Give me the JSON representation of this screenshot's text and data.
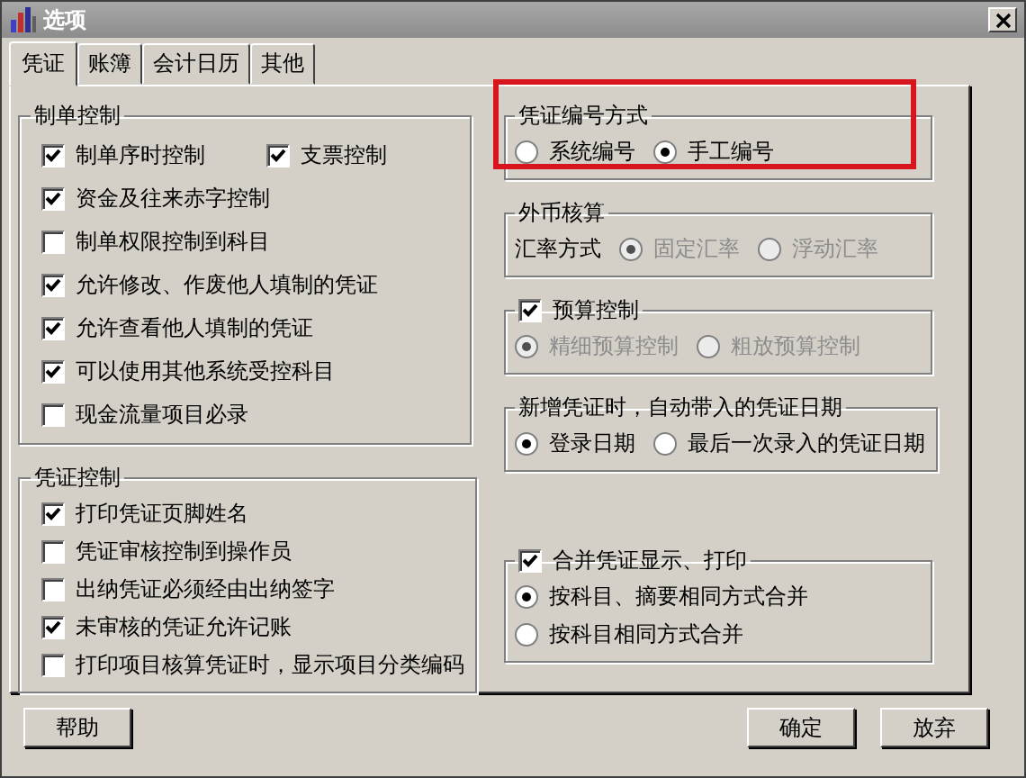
{
  "window": {
    "title": "选项"
  },
  "tabs": [
    {
      "label": "凭证",
      "selected": true
    },
    {
      "label": "账簿",
      "selected": false
    },
    {
      "label": "会计日历",
      "selected": false
    },
    {
      "label": "其他",
      "selected": false
    }
  ],
  "left_groups": [
    {
      "highlighted": false,
      "header": {
        "kind": "text",
        "label": "制单控制"
      },
      "rows": [
        [
          {
            "kind": "checkbox",
            "label": "制单序时控制",
            "checked": true,
            "disabled": false
          },
          {
            "kind": "checkbox",
            "label": "支票控制",
            "checked": true,
            "disabled": false
          }
        ],
        [
          {
            "kind": "checkbox",
            "label": "资金及往来赤字控制",
            "checked": true,
            "disabled": false
          }
        ],
        [
          {
            "kind": "checkbox",
            "label": "制单权限控制到科目",
            "checked": false,
            "disabled": false
          }
        ],
        [
          {
            "kind": "checkbox",
            "label": "允许修改、作废他人填制的凭证",
            "checked": true,
            "disabled": false
          }
        ],
        [
          {
            "kind": "checkbox",
            "label": "允许查看他人填制的凭证",
            "checked": true,
            "disabled": false
          }
        ],
        [
          {
            "kind": "checkbox",
            "label": "可以使用其他系统受控科目",
            "checked": true,
            "disabled": false
          }
        ],
        [
          {
            "kind": "checkbox",
            "label": "现金流量项目必录",
            "checked": false,
            "disabled": false
          }
        ]
      ]
    },
    {
      "highlighted": false,
      "header": {
        "kind": "text",
        "label": "凭证控制"
      },
      "rows": [
        [
          {
            "kind": "checkbox",
            "label": "打印凭证页脚姓名",
            "checked": true,
            "disabled": false
          }
        ],
        [
          {
            "kind": "checkbox",
            "label": "凭证审核控制到操作员",
            "checked": false,
            "disabled": false
          }
        ],
        [
          {
            "kind": "checkbox",
            "label": "出纳凭证必须经由出纳签字",
            "checked": false,
            "disabled": false
          }
        ],
        [
          {
            "kind": "checkbox",
            "label": "未审核的凭证允许记账",
            "checked": true,
            "disabled": false
          }
        ],
        [
          {
            "kind": "checkbox",
            "label": "打印项目核算凭证时，显示项目分类编码",
            "checked": false,
            "disabled": false
          }
        ]
      ]
    }
  ],
  "right_groups": [
    {
      "highlighted": true,
      "header": {
        "kind": "text",
        "label": "凭证编号方式"
      },
      "rows": [
        [
          {
            "kind": "radio",
            "label": "系统编号",
            "selected": false,
            "disabled": false
          },
          {
            "kind": "radio",
            "label": "手工编号",
            "selected": true,
            "disabled": false
          }
        ]
      ]
    },
    {
      "highlighted": false,
      "header": {
        "kind": "text",
        "label": "外币核算"
      },
      "rows": [
        [
          {
            "kind": "text",
            "label": "汇率方式",
            "disabled": false
          },
          {
            "kind": "radio",
            "label": "固定汇率",
            "selected": true,
            "disabled": true
          },
          {
            "kind": "radio",
            "label": "浮动汇率",
            "selected": false,
            "disabled": true
          }
        ]
      ]
    },
    {
      "highlighted": false,
      "header": {
        "kind": "checkbox",
        "label": "预算控制",
        "checked": true
      },
      "rows": [
        [
          {
            "kind": "radio",
            "label": "精细预算控制",
            "selected": true,
            "disabled": true
          },
          {
            "kind": "radio",
            "label": "粗放预算控制",
            "selected": false,
            "disabled": true
          }
        ]
      ]
    },
    {
      "highlighted": false,
      "header": {
        "kind": "text",
        "label": "新增凭证时，自动带入的凭证日期"
      },
      "rows": [
        [
          {
            "kind": "radio",
            "label": "登录日期",
            "selected": true,
            "disabled": false
          },
          {
            "kind": "radio",
            "label": "最后一次录入的凭证日期",
            "selected": false,
            "disabled": false
          }
        ]
      ]
    },
    {
      "highlighted": false,
      "header": {
        "kind": "checkbox",
        "label": "合并凭证显示、打印",
        "checked": true
      },
      "rows": [
        [
          {
            "kind": "radio",
            "label": "按科目、摘要相同方式合并",
            "selected": true,
            "disabled": false
          }
        ],
        [
          {
            "kind": "radio",
            "label": "按科目相同方式合并",
            "selected": false,
            "disabled": false
          }
        ]
      ]
    }
  ],
  "buttons": [
    {
      "label": "帮助"
    },
    {
      "label": "确定"
    },
    {
      "label": "放弃"
    }
  ]
}
